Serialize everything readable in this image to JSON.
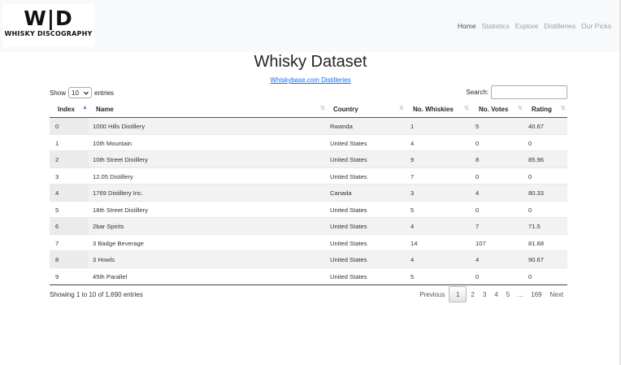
{
  "brand": {
    "mark": "W|D",
    "name": "WHISKY DISCOGRAPHY"
  },
  "nav": [
    "Home",
    "Statistics",
    "Explore",
    "Distilleries",
    "Our Picks"
  ],
  "page": {
    "title": "Whisky Dataset",
    "source_link": "Whiskybase.com Distilleries"
  },
  "controls": {
    "show_label": "Show",
    "entries_value": "10",
    "entries_label": "entries",
    "search_label": "Search:",
    "search_value": ""
  },
  "table": {
    "columns": [
      "Index",
      "Name",
      "Country",
      "No. Whiskies",
      "No. Votes",
      "Rating"
    ],
    "rows": [
      [
        "0",
        "1000 Hills Distillery",
        "Rwanda",
        "1",
        "5",
        "40.67"
      ],
      [
        "1",
        "10th Mountain",
        "United States",
        "4",
        "0",
        "0"
      ],
      [
        "2",
        "10th Street Distillery",
        "United States",
        "9",
        "8",
        "85.96"
      ],
      [
        "3",
        "12.05 Distillery",
        "United States",
        "7",
        "0",
        "0"
      ],
      [
        "4",
        "1769 Distillery Inc.",
        "Canada",
        "3",
        "4",
        "80.33"
      ],
      [
        "5",
        "18th Street Distillery",
        "United States",
        "5",
        "0",
        "0"
      ],
      [
        "6",
        "2bar Spirits",
        "United States",
        "4",
        "7",
        "71.5"
      ],
      [
        "7",
        "3 Badge Beverage",
        "United States",
        "14",
        "107",
        "81.68"
      ],
      [
        "8",
        "3 Howls",
        "United States",
        "4",
        "4",
        "90.67"
      ],
      [
        "9",
        "45th Parallel",
        "United States",
        "5",
        "0",
        "0"
      ]
    ]
  },
  "footer": {
    "info": "Showing 1 to 10 of 1,690 entries",
    "previous": "Previous",
    "pages": [
      "1",
      "2",
      "3",
      "4",
      "5",
      "…",
      "169"
    ],
    "next": "Next"
  }
}
